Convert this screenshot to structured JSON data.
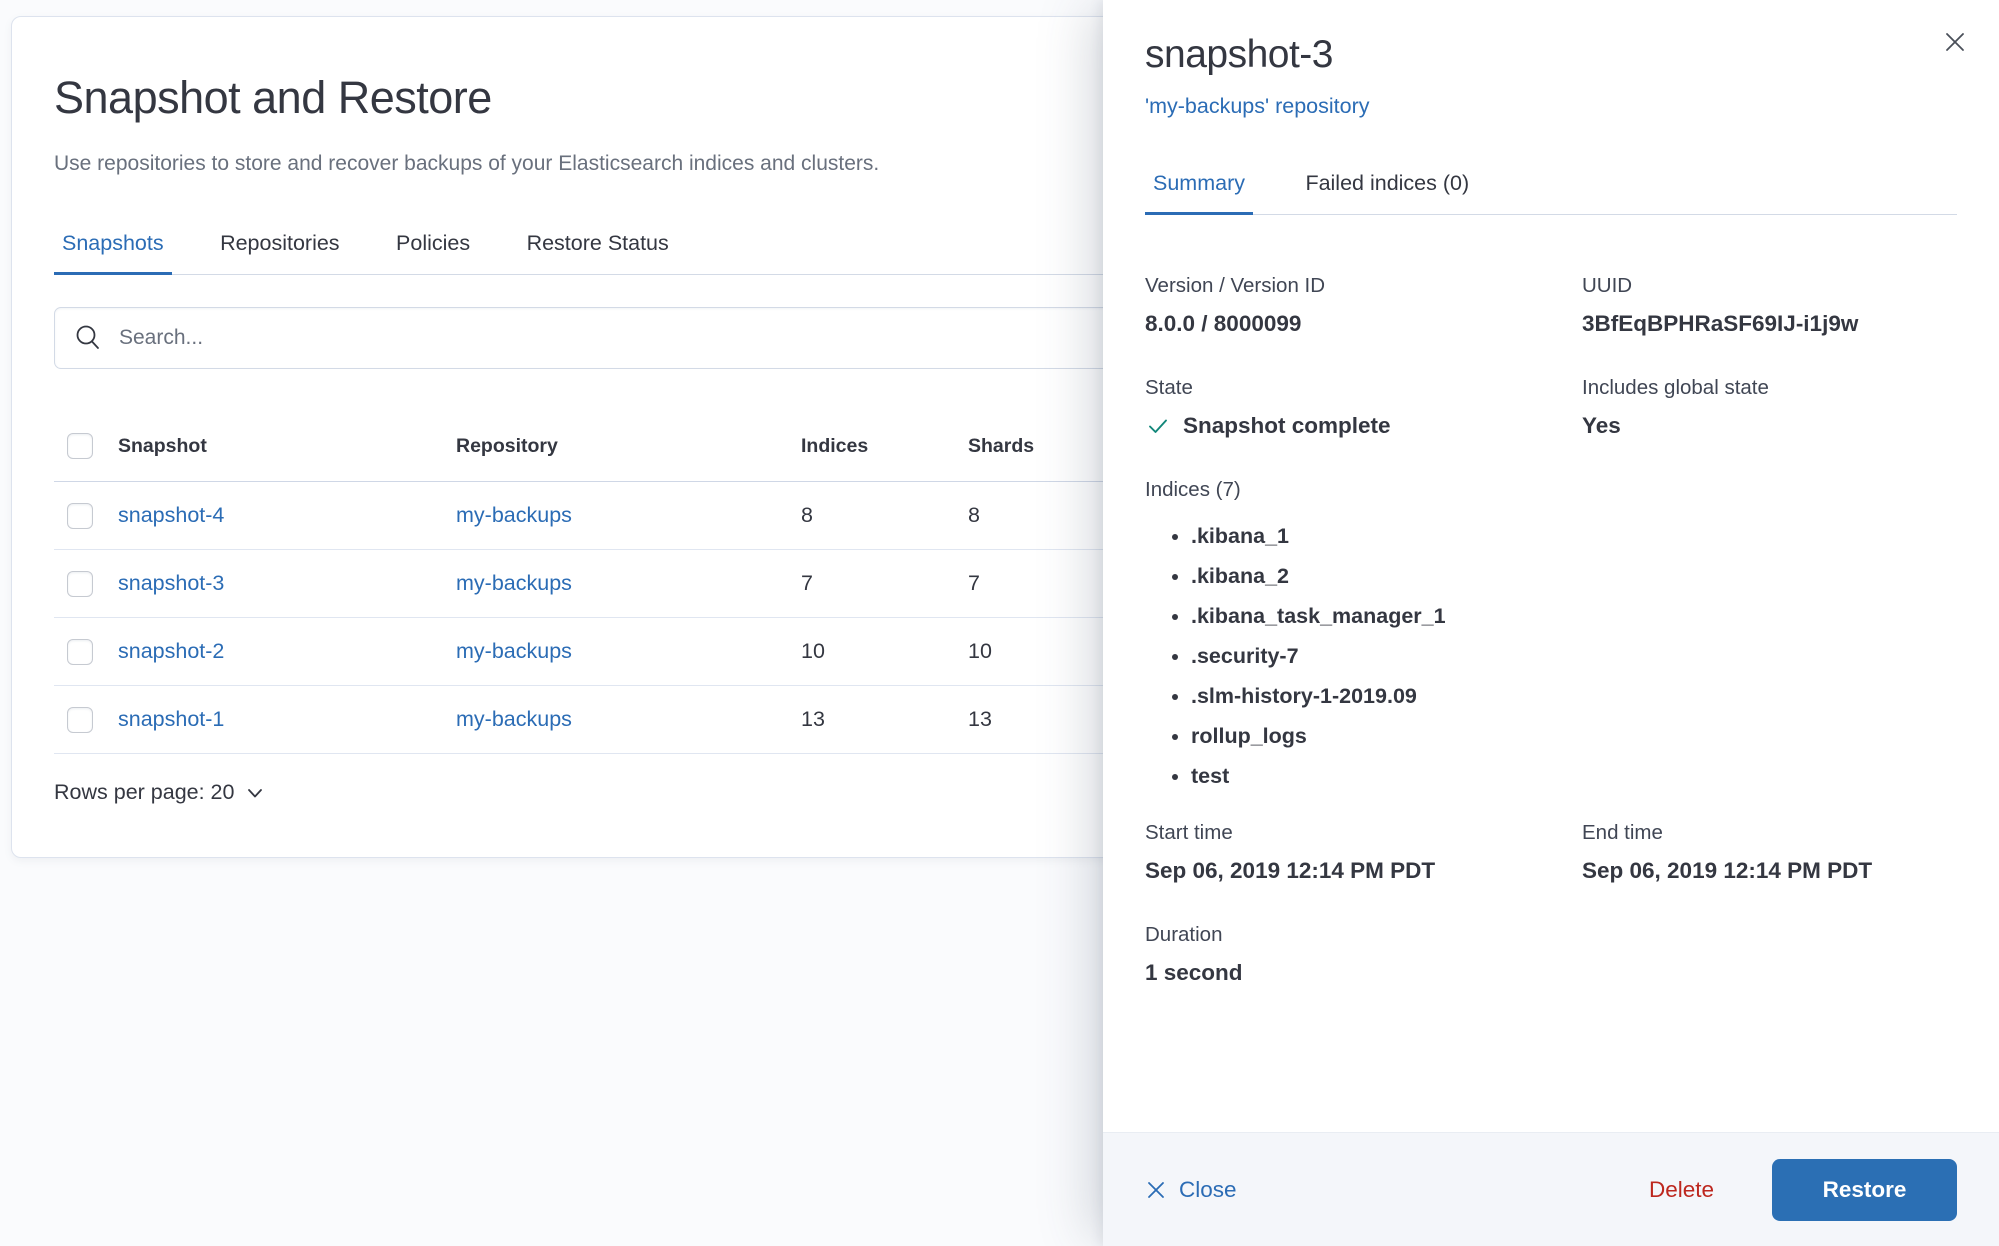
{
  "page": {
    "title": "Snapshot and Restore",
    "subtitle": "Use repositories to store and recover backups of your Elasticsearch indices and clusters.",
    "tabs": [
      {
        "label": "Snapshots",
        "active": true
      },
      {
        "label": "Repositories",
        "active": false
      },
      {
        "label": "Policies",
        "active": false
      },
      {
        "label": "Restore Status",
        "active": false
      }
    ],
    "search": {
      "placeholder": "Search..."
    },
    "table": {
      "columns": [
        "Snapshot",
        "Repository",
        "Indices",
        "Shards"
      ],
      "rows": [
        {
          "snapshot": "snapshot-4",
          "repository": "my-backups",
          "indices": "8",
          "shards": "8"
        },
        {
          "snapshot": "snapshot-3",
          "repository": "my-backups",
          "indices": "7",
          "shards": "7"
        },
        {
          "snapshot": "snapshot-2",
          "repository": "my-backups",
          "indices": "10",
          "shards": "10"
        },
        {
          "snapshot": "snapshot-1",
          "repository": "my-backups",
          "indices": "13",
          "shards": "13"
        }
      ]
    },
    "pagination": {
      "rows_per_page_label": "Rows per page: 20"
    }
  },
  "flyout": {
    "title": "snapshot-3",
    "repository_link": "'my-backups' repository",
    "tabs": [
      {
        "label": "Summary",
        "active": true
      },
      {
        "label": "Failed indices (0)",
        "active": false
      }
    ],
    "summary": {
      "version_label": "Version / Version ID",
      "version_value": "8.0.0 / 8000099",
      "uuid_label": "UUID",
      "uuid_value": "3BfEqBPHRaSF69IJ-i1j9w",
      "state_label": "State",
      "state_value": "Snapshot complete",
      "global_state_label": "Includes global state",
      "global_state_value": "Yes",
      "indices_label": "Indices (7)",
      "indices": [
        ".kibana_1",
        ".kibana_2",
        ".kibana_task_manager_1",
        ".security-7",
        ".slm-history-1-2019.09",
        "rollup_logs",
        "test"
      ],
      "start_time_label": "Start time",
      "start_time_value": "Sep 06, 2019 12:14 PM PDT",
      "end_time_label": "End time",
      "end_time_value": "Sep 06, 2019 12:14 PM PDT",
      "duration_label": "Duration",
      "duration_value": "1 second"
    },
    "footer": {
      "close_label": "Close",
      "delete_label": "Delete",
      "restore_label": "Restore"
    }
  },
  "colors": {
    "accent_blue": "#2b6cb5",
    "danger_red": "#bd271e",
    "success_teal": "#12877a"
  }
}
